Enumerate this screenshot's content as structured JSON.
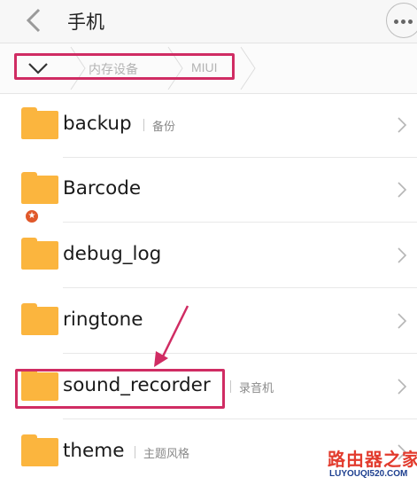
{
  "header": {
    "title": "手机",
    "back_icon": "chevron-left-icon",
    "more_icon": "more-dots-icon"
  },
  "breadcrumb": {
    "toggle_icon": "chevron-down-icon",
    "items": [
      "内存设备",
      "MIUI"
    ]
  },
  "folders": [
    {
      "name": "backup",
      "desc": "备份",
      "icon": "folder-icon"
    },
    {
      "name": "Barcode",
      "desc": "",
      "icon": "folder-icon"
    },
    {
      "name": "debug_log",
      "desc": "",
      "icon": "folder-icon"
    },
    {
      "name": "ringtone",
      "desc": "",
      "icon": "folder-icon",
      "badge": "★"
    },
    {
      "name": "sound_recorder",
      "desc": "录音机",
      "icon": "folder-icon"
    },
    {
      "name": "theme",
      "desc": "主题风格",
      "icon": "folder-icon"
    }
  ],
  "annotation_color": "#d02c63",
  "folder_color": "#fbb53e",
  "watermark": {
    "main": "路由器之家",
    "sub": "LUYOUQI520.COM"
  }
}
